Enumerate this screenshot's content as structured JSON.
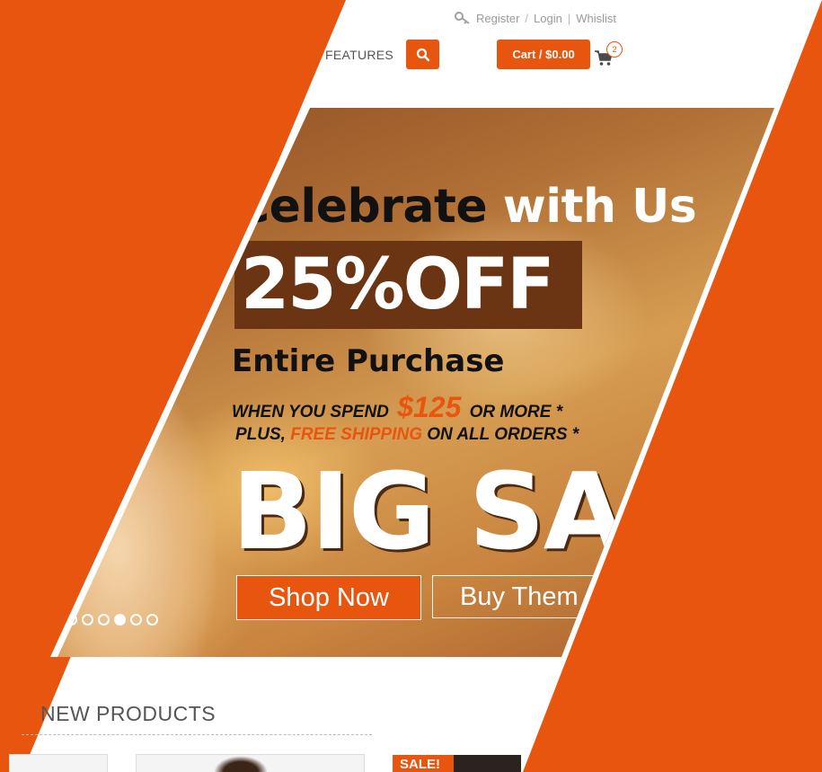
{
  "header": {
    "links": {
      "register": "Register",
      "sep1": "/",
      "login": "Login",
      "sep2": "|",
      "wishlist": "Whislist"
    },
    "nav_partial": "FEATURES",
    "cart_label": "Cart / $0.00",
    "cart_count": "2"
  },
  "banner": {
    "headline_dark": "Celebrate",
    "headline_light": "with Us",
    "discount": "25%OFF",
    "subhead": "Entire Purchase",
    "spend_prefix": "WHEN YOU SPEND",
    "spend_price": "$125",
    "spend_suffix": "OR MORE *",
    "ship_prefix": "PLUS,",
    "ship_free": "FREE SHIPPING",
    "ship_suffix": "ON ALL ORDERS *",
    "big_text": "BIG SALE",
    "buttons": {
      "primary": "Shop Now",
      "secondary": "Buy Them"
    },
    "slider": {
      "count": 6,
      "active_index": 3
    }
  },
  "new_products": {
    "title": "NEW PRODUCTS",
    "sale_badge": "SALE!"
  },
  "colors": {
    "accent": "#e8550f",
    "discount_box": "#6b3513"
  }
}
